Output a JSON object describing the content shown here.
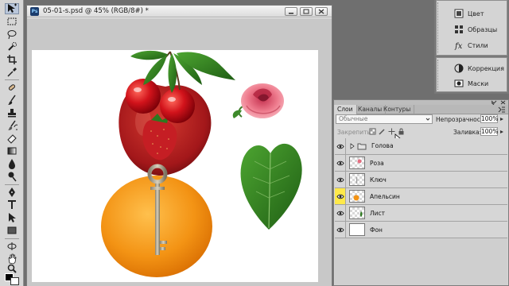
{
  "document": {
    "title": "05-01-s.psd @ 45% (RGB/8#) *"
  },
  "dock": {
    "items": [
      {
        "label": "Цвет",
        "icon": "color-icon"
      },
      {
        "label": "Образцы",
        "icon": "swatches-icon"
      },
      {
        "label": "Стили",
        "icon": "styles-icon"
      },
      {
        "label": "Коррекция",
        "icon": "adjustments-icon"
      },
      {
        "label": "Маски",
        "icon": "masks-icon"
      }
    ]
  },
  "layers_panel": {
    "tabs": [
      "Слои",
      "Каналы",
      "Контуры"
    ],
    "active_tab": "Слои",
    "blend_mode": "Обычные",
    "opacity_label": "Непрозрачность:",
    "opacity_value": "100%",
    "lock_label": "Закрепить:",
    "fill_label": "Заливка:",
    "fill_value": "100%",
    "layers": [
      {
        "name": "Голова",
        "type": "group",
        "visible": true
      },
      {
        "name": "Роза",
        "type": "layer",
        "visible": true
      },
      {
        "name": "Ключ",
        "type": "layer",
        "visible": true
      },
      {
        "name": "Апельсин",
        "type": "layer",
        "visible": true,
        "highlighted": true
      },
      {
        "name": "Лист",
        "type": "layer",
        "visible": true
      },
      {
        "name": "Фон",
        "type": "background",
        "visible": true
      }
    ]
  },
  "colors": {
    "highlight": "#ffe94a",
    "selection": "#b9c6da"
  }
}
